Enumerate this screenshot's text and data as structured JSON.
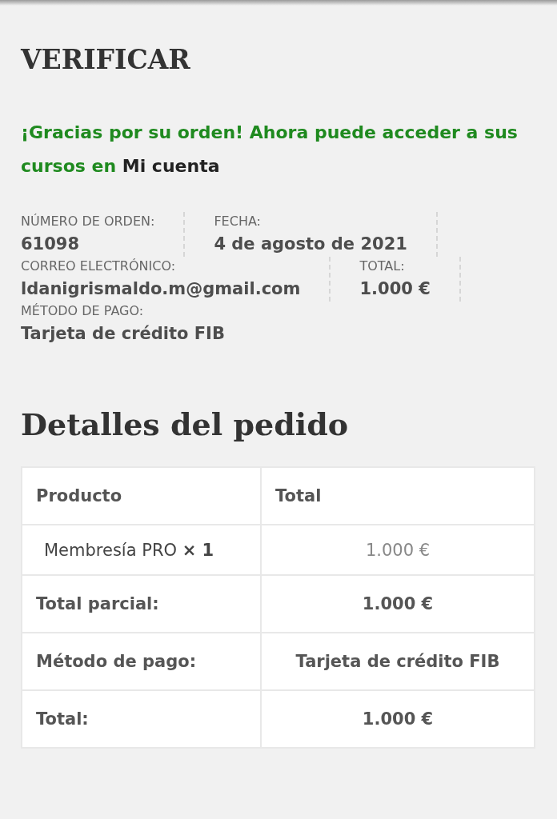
{
  "page_title": "VERIFICAR",
  "notice": {
    "text": "¡Gracias por su orden! Ahora puede acceder a sus cursos en",
    "link": "Mi cuenta"
  },
  "overview": [
    {
      "label": "NÚMERO DE ORDEN:",
      "value": "61098"
    },
    {
      "label": "FECHA:",
      "value": "4 de agosto de 2021"
    },
    {
      "label": "CORREO ELECTRÓNICO:",
      "value": "ldanigrismaldo.m@gmail.com"
    },
    {
      "label": "TOTAL:",
      "value": "1.000 €"
    },
    {
      "label": "MÉTODO DE PAGO:",
      "value": "Tarjeta de crédito FIB"
    }
  ],
  "details": {
    "title": "Detalles del pedido",
    "columns": [
      "Producto",
      "Total"
    ],
    "rows": [
      {
        "kind": "item",
        "label": "Membresía PRO **× 1**",
        "value": "1.000 €"
      },
      {
        "kind": "total",
        "label": "Total parcial:",
        "value": "1.000 €"
      },
      {
        "kind": "total",
        "label": "Método de pago:",
        "value": "Tarjeta de crédito FIB"
      },
      {
        "kind": "total",
        "label": "Total:",
        "value": "1.000 €"
      }
    ]
  }
}
